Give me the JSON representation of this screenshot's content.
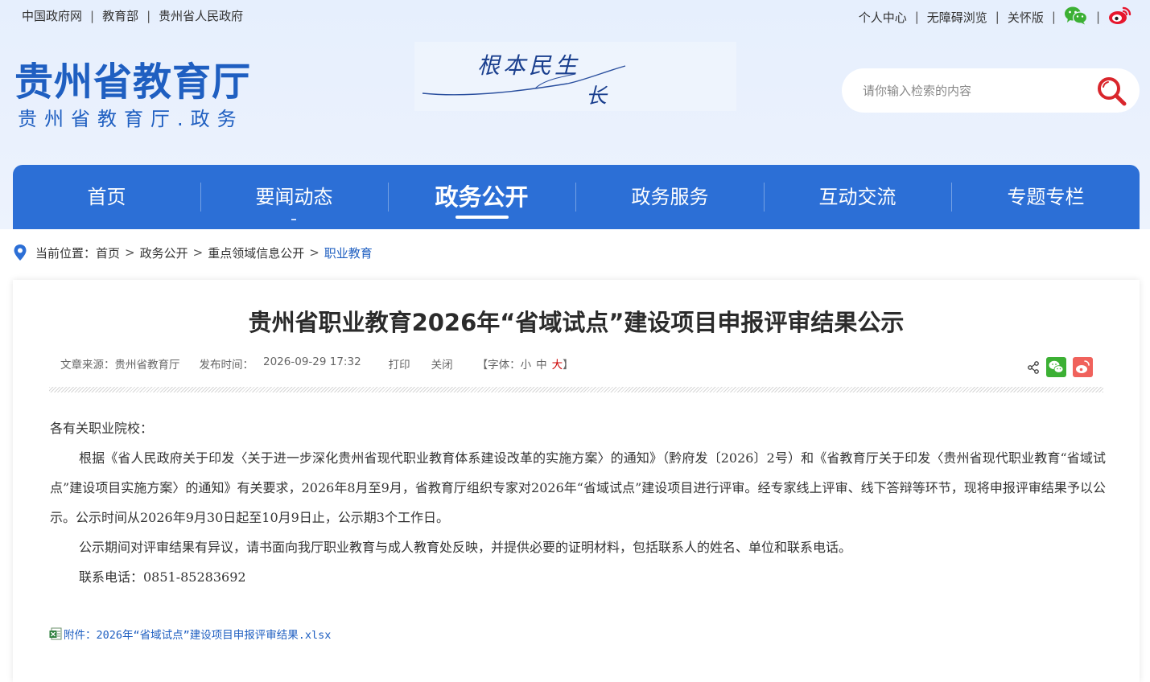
{
  "topbar": {
    "left_links": [
      "中国政府网",
      "教育部",
      "贵州省人民政府"
    ],
    "right_links": [
      "个人中心",
      "无障碍浏览",
      "关怀版"
    ],
    "separator": "|",
    "icons": [
      "wechat-icon",
      "weibo-icon"
    ]
  },
  "logo": {
    "title": "贵州省教育厅",
    "subtitle": "贵州省教育厅.政务"
  },
  "banner": {
    "line1": "根本民生",
    "line2": "长"
  },
  "search": {
    "placeholder": "请你输入检索的内容",
    "icon": "search-icon"
  },
  "nav": {
    "items": [
      "首页",
      "要闻动态",
      "政务公开",
      "政务服务",
      "互动交流",
      "专题专栏"
    ],
    "active_index": 2
  },
  "breadcrumb": {
    "label": "当前位置：",
    "items": [
      "首页",
      "政务公开",
      "重点领域信息公开",
      "职业教育"
    ],
    "separator": ">"
  },
  "article": {
    "title": "贵州省职业教育2026年“省域试点”建设项目申报评审结果公示",
    "source_label": "文章来源：",
    "source": "贵州省教育厅",
    "date_label": "发布时间：",
    "date": "2026-09-29 17:32",
    "print": "打印",
    "close": "关闭",
    "font_open": "【字体：",
    "font_small": "小",
    "font_medium": "中",
    "font_large": "大",
    "font_close": "】",
    "share_icons": [
      "share-icon",
      "wechat-share-icon",
      "weibo-share-icon"
    ],
    "salutation": "各有关职业院校：",
    "paragraphs": [
      "根据《省人民政府关于印发〈关于进一步深化贵州省现代职业教育体系建设改革的实施方案〉的通知》（黔府发〔2026〕2号）和《省教育厅关于印发〈贵州省现代职业教育“省域试点”建设项目实施方案〉的通知》有关要求，2026年8月至9月，省教育厅组织专家对2026年“省域试点”建设项目进行评审。经专家线上评审、线下答辩等环节，现将申报评审结果予以公示。公示时间从2026年9月30日起至10月9日止，公示期3个工作日。",
      "公示期间对评审结果有异议，请书面向我厅职业教育与成人教育处反映，并提供必要的证明材料，包括联系人的姓名、单位和联系电话。",
      "联系电话：0851-85283692"
    ],
    "attachment": "附件：2026年“省域试点”建设项目申报评审结果.xlsx"
  },
  "colors": {
    "brand_blue": "#2c6fd6",
    "logo_blue": "#1f5fc1",
    "search_red": "#d9262c",
    "wechat_green": "#3cb034",
    "weibo_red": "#e6162d"
  }
}
